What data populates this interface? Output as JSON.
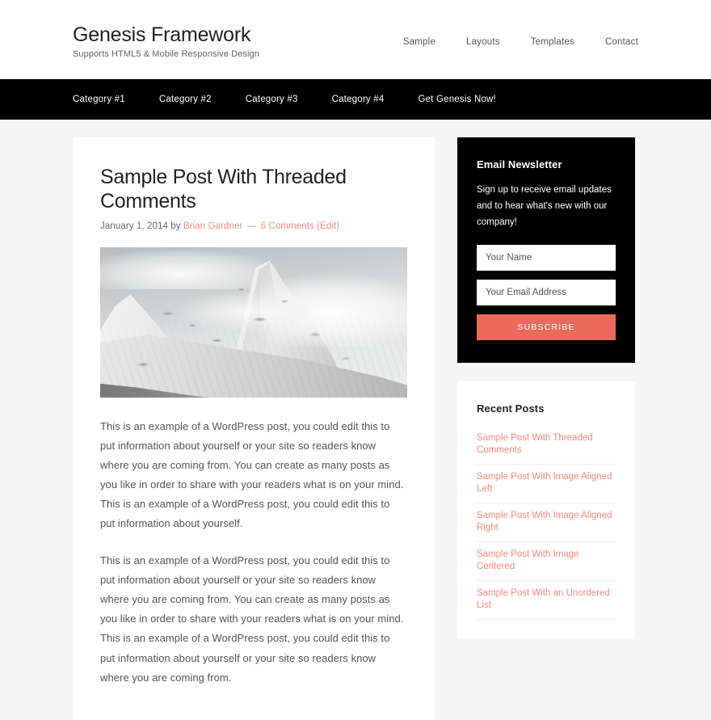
{
  "header": {
    "site_title": "Genesis Framework",
    "site_description": "Supports HTML5 & Mobile Responsive Design",
    "nav": [
      {
        "label": "Sample"
      },
      {
        "label": "Layouts"
      },
      {
        "label": "Templates"
      },
      {
        "label": "Contact"
      }
    ]
  },
  "primary_nav": [
    {
      "label": "Category #1"
    },
    {
      "label": "Category #2"
    },
    {
      "label": "Category #3"
    },
    {
      "label": "Category #4"
    },
    {
      "label": "Get Genesis Now!"
    }
  ],
  "post": {
    "title": "Sample Post With Threaded Comments",
    "meta": {
      "date": "January 1, 2014",
      "by_label": "by",
      "author": "Brian Gardner",
      "separator": "—",
      "comments": "6 Comments",
      "edit": "(Edit)"
    },
    "featured_image_alt": "Snow covered mountain peak with clouds, black and white",
    "paragraphs": [
      "This is an example of a WordPress post, you could edit this to put information about yourself or your site so readers know where you are coming from. You can create as many posts as you like in order to share with your readers what is on your mind. This is an example of a WordPress post, you could edit this to put information about yourself.",
      "This is an example of a WordPress post, you could edit this to put information about yourself or your site so readers know where you are coming from. You can create as many posts as you like in order to share with your readers what is on your mind. This is an example of a WordPress post, you could edit this to put information about yourself or your site so readers know where you are coming from."
    ]
  },
  "sidebar": {
    "newsletter": {
      "title": "Email Newsletter",
      "text": "Sign up to receive email updates and to hear what's new with our company!",
      "name_placeholder": "Your Name",
      "email_placeholder": "Your Email Address",
      "submit_label": "SUBSCRIBE",
      "accent_color": "#ec6a5c"
    },
    "recent_posts": {
      "title": "Recent Posts",
      "link_color": "#f08a80",
      "items": [
        {
          "label": "Sample Post With Threaded Comments"
        },
        {
          "label": "Sample Post With Image Aligned Left"
        },
        {
          "label": "Sample Post With Image Aligned Right"
        },
        {
          "label": "Sample Post With Image Centered"
        },
        {
          "label": "Sample Post With an Unordered List"
        }
      ]
    }
  }
}
